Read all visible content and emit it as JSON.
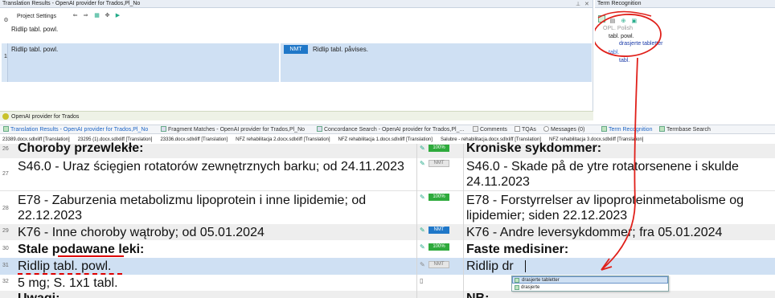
{
  "translation_results": {
    "title": "Translation Results - OpenAI provider for Trados,Pl_No",
    "toolbar_label": "Project Settings",
    "preview_text": "Ridlip tabl. powl.",
    "result": {
      "index": "1",
      "source": "Ridlip tabl. powl.",
      "badge": "NMT",
      "target": "Ridlip tabl. påvises."
    },
    "provider_label": "OpenAI provider for Trados"
  },
  "term_recognition": {
    "title": "Term Recognition",
    "language": "OPL. Polish",
    "terms": [
      {
        "source": "tabl. powl.",
        "target": "drasjerte tabletter"
      },
      {
        "source": "tabl.",
        "target": "tabl."
      }
    ]
  },
  "tabs": [
    "Translation Results - OpenAI provider for Trados,Pl_No",
    "Fragment Matches - OpenAI provider for Trados,Pl_No",
    "Concordance Search - OpenAI provider for Trados,Pl_...",
    "Comments",
    "TQAs",
    "Messages (0)",
    "Term Recognition",
    "Termbase Search"
  ],
  "doc_tabs": [
    "23389.docx.sdlxliff [Translation]",
    "23295 (1).docx.sdlxliff [Translation]",
    "23336.docx.sdlxliff [Translation]",
    "NFZ rehabilitacja 2.docx.sdlxliff [Translation]",
    "NFZ rehabilitacja 1.docx.sdlxliff [Translation]",
    "Salubre - rehabilitacja.docx.sdlxliff [Translation]",
    "NFZ rehabilitacja 3.docx.sdlxliff [Translation]"
  ],
  "segments": [
    {
      "num": "26",
      "src": "Choroby przewlekłe:",
      "status": "100%",
      "tgt": "Kroniske sykdommer:"
    },
    {
      "num": "27",
      "src": "S46.0 - Uraz ścięgien rotatorów zewnętrznych barku; od 24.11.2023",
      "status": "NMT",
      "tgt": "S46.0 - Skade på de ytre rotatorsenene i skulde 24.11.2023"
    },
    {
      "num": "28",
      "src": "E78 - Zaburzenia metabolizmu lipoprotein i inne lipidemie; od 22.12.2023",
      "status": "100%",
      "tgt": "E78 - Forstyrrelser av lipoproteinmetabolisme og lipidemier; siden 22.12.2023"
    },
    {
      "num": "29",
      "src": "K76 - Inne choroby wątroby; od 05.01.2024",
      "status": "NMT",
      "tgt": "K76 - Andre leversykdommer; fra 05.01.2024"
    },
    {
      "num": "30",
      "src": "Stale podawane leki:",
      "status": "100%",
      "tgt": "Faste medisiner:"
    },
    {
      "num": "31",
      "src": "Ridlip tabl. powl.",
      "status": "NMT",
      "tgt": "Ridlip dr"
    },
    {
      "num": "32",
      "src": "5 mg; S. 1x1 tabl.",
      "status": "",
      "tgt": ""
    },
    {
      "num": "",
      "src": "Uwagi:",
      "status": "",
      "tgt": "NB:"
    }
  ],
  "autosuggest": [
    "drasjerte tabletter",
    "drasjerte"
  ],
  "colors": {
    "annotation_red": "#e0201a",
    "selected_row": "#cfe0f3",
    "nmt_blue": "#1f77c8",
    "match_green": "#2eaa3c"
  }
}
